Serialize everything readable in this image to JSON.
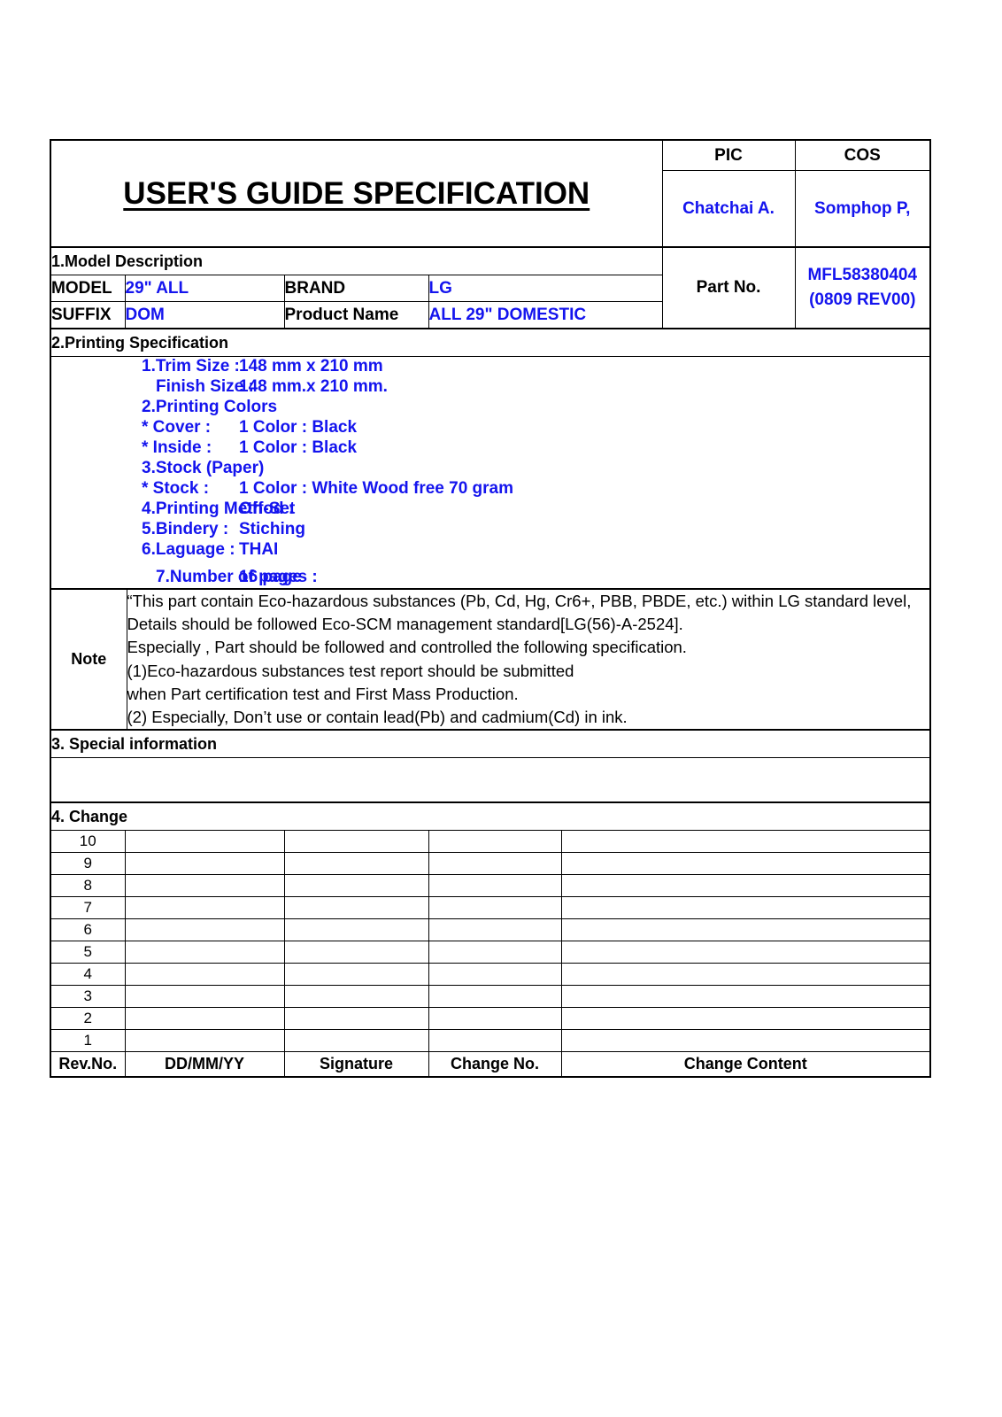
{
  "document": {
    "title": "USER'S GUIDE SPECIFICATION"
  },
  "approval": {
    "pic_header": "PIC",
    "cos_header": "COS",
    "pic_name": "Chatchai A.",
    "cos_name": "Somphop P,"
  },
  "model_description": {
    "section_title": "1.Model Description",
    "model_label": "MODEL",
    "model_value": "29\" ALL",
    "brand_label": "BRAND",
    "brand_value": "LG",
    "suffix_label": "SUFFIX",
    "suffix_value": "DOM",
    "product_name_label": "Product Name",
    "product_name_value": "ALL 29\" DOMESTIC",
    "part_no_label": "Part No.",
    "part_no_value": "MFL58380404",
    "part_no_rev": "(0809 REV00)"
  },
  "printing_specification": {
    "section_title": "2.Printing Specification",
    "rows": [
      {
        "key": "1.Trim Size :",
        "value": "148 mm x 210 mm",
        "indent": false,
        "gap": false
      },
      {
        "key": "Finish Size :",
        "value": "148 mm.x 210 mm.",
        "indent": true,
        "gap": false
      },
      {
        "key": "2.Printing Colors",
        "value": "",
        "indent": false,
        "gap": false
      },
      {
        "key": "* Cover :",
        "value": "1 Color : Black",
        "indent": false,
        "gap": false
      },
      {
        "key": "* Inside :",
        "value": "1 Color : Black",
        "indent": false,
        "gap": false
      },
      {
        "key": "3.Stock (Paper)",
        "value": "",
        "indent": false,
        "gap": false
      },
      {
        "key": "* Stock :",
        "value": "1 Color : White Wood free 70 gram",
        "indent": false,
        "gap": false
      },
      {
        "key": "4.Printing Method :",
        "value": "Off-Set",
        "indent": false,
        "gap": false
      },
      {
        "key": "5.Bindery :",
        "value": "Stiching",
        "indent": false,
        "gap": false
      },
      {
        "key": "6.Laguage :",
        "value": "THAI",
        "indent": false,
        "gap": false
      },
      {
        "key": "7.Number of pages :",
        "value": "16 page",
        "indent": true,
        "gap": true
      }
    ]
  },
  "note": {
    "label": "Note",
    "lines": [
      "“This part contain Eco-hazardous substances (Pb, Cd, Hg, Cr6+, PBB, PBDE, etc.) within LG standard level,",
      "Details should be followed Eco-SCM management standard[LG(56)-A-2524].",
      "Especially , Part should be followed and controlled the following specification.",
      "(1)Eco-hazardous substances test report should be submitted",
      "when Part certification test and First Mass Production.",
      "(2) Especially, Don’t use or contain lead(Pb) and cadmium(Cd) in ink."
    ]
  },
  "special_information": {
    "section_title": "3. Special information",
    "content": ""
  },
  "change": {
    "section_title": "4. Change",
    "rows": [
      {
        "rev_no": "10",
        "date": "",
        "signature": "",
        "change_no": "",
        "change_content": ""
      },
      {
        "rev_no": "9",
        "date": "",
        "signature": "",
        "change_no": "",
        "change_content": ""
      },
      {
        "rev_no": "8",
        "date": "",
        "signature": "",
        "change_no": "",
        "change_content": ""
      },
      {
        "rev_no": "7",
        "date": "",
        "signature": "",
        "change_no": "",
        "change_content": ""
      },
      {
        "rev_no": "6",
        "date": "",
        "signature": "",
        "change_no": "",
        "change_content": ""
      },
      {
        "rev_no": "5",
        "date": "",
        "signature": "",
        "change_no": "",
        "change_content": ""
      },
      {
        "rev_no": "4",
        "date": "",
        "signature": "",
        "change_no": "",
        "change_content": ""
      },
      {
        "rev_no": "3",
        "date": "",
        "signature": "",
        "change_no": "",
        "change_content": ""
      },
      {
        "rev_no": "2",
        "date": "",
        "signature": "",
        "change_no": "",
        "change_content": ""
      },
      {
        "rev_no": "1",
        "date": "",
        "signature": "",
        "change_no": "",
        "change_content": ""
      }
    ],
    "footer": {
      "rev_no": "Rev.No.",
      "date": "DD/MM/YY",
      "signature": "Signature",
      "change_no": "Change No.",
      "change_content": "Change Content"
    }
  },
  "colors": {
    "text": "#000000",
    "accent_blue": "#1414ee",
    "border": "#000000",
    "background": "#ffffff"
  }
}
